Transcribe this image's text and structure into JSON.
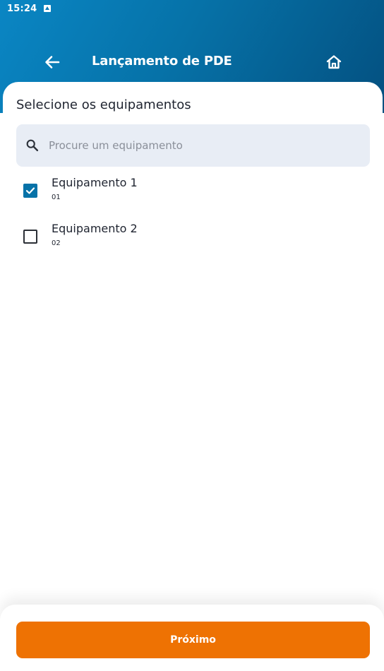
{
  "status_bar": {
    "time": "15:24",
    "notification_icon": "photo-notification-icon"
  },
  "app_bar": {
    "title": "Lançamento de PDE",
    "back_icon": "arrow-left-icon",
    "home_icon": "home-icon"
  },
  "content": {
    "section_title": "Selecione os equipamentos",
    "search": {
      "placeholder": "Procure um equipamento",
      "value": "",
      "icon": "search-icon"
    },
    "equipment": [
      {
        "name": "Equipamento 1",
        "code": "01",
        "checked": true
      },
      {
        "name": "Equipamento 2",
        "code": "02",
        "checked": false
      }
    ]
  },
  "footer": {
    "next_label": "Próximo"
  },
  "colors": {
    "header_gradient_start": "#0a86c4",
    "header_gradient_end": "#045080",
    "accent": "#0672a8",
    "primary_button": "#ee7203",
    "search_bg": "#e8edf5"
  }
}
